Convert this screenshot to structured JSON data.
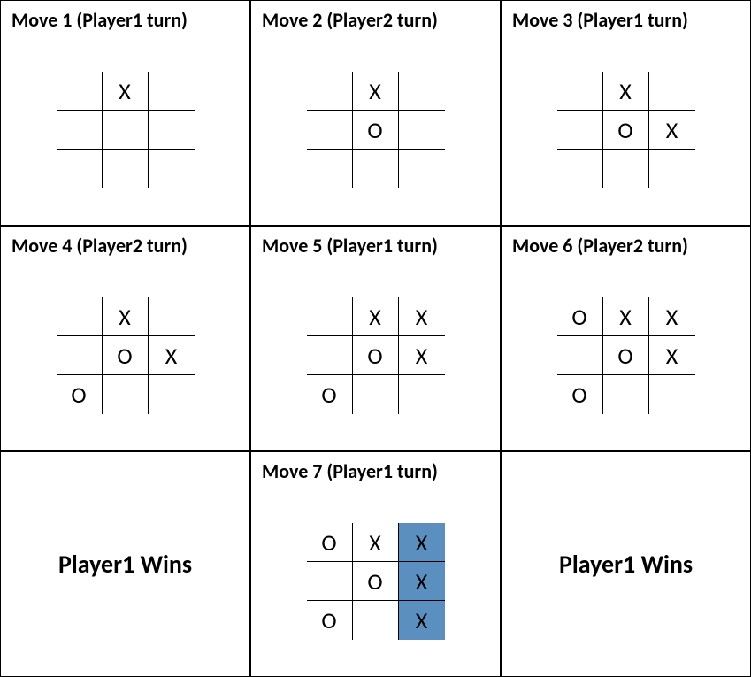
{
  "panels": [
    {
      "type": "move",
      "title": "Move 1 (Player1 turn)",
      "board": [
        [
          "",
          "X",
          ""
        ],
        [
          "",
          "",
          ""
        ],
        [
          "",
          "",
          ""
        ]
      ],
      "highlight": []
    },
    {
      "type": "move",
      "title": "Move 2 (Player2 turn)",
      "board": [
        [
          "",
          "X",
          ""
        ],
        [
          "",
          "O",
          ""
        ],
        [
          "",
          "",
          ""
        ]
      ],
      "highlight": []
    },
    {
      "type": "move",
      "title": "Move 3 (Player1 turn)",
      "board": [
        [
          "",
          "X",
          ""
        ],
        [
          "",
          "O",
          "X"
        ],
        [
          "",
          "",
          ""
        ]
      ],
      "highlight": []
    },
    {
      "type": "move",
      "title": "Move 4 (Player2 turn)",
      "board": [
        [
          "",
          "X",
          ""
        ],
        [
          "",
          "O",
          "X"
        ],
        [
          "O",
          "",
          ""
        ]
      ],
      "highlight": []
    },
    {
      "type": "move",
      "title": "Move 5 (Player1 turn)",
      "board": [
        [
          "",
          "X",
          "X"
        ],
        [
          "",
          "O",
          "X"
        ],
        [
          "O",
          "",
          ""
        ]
      ],
      "highlight": []
    },
    {
      "type": "move",
      "title": "Move 6 (Player2 turn)",
      "board": [
        [
          "O",
          "X",
          "X"
        ],
        [
          "",
          "O",
          "X"
        ],
        [
          "O",
          "",
          ""
        ]
      ],
      "highlight": []
    },
    {
      "type": "win",
      "text": "Player1 Wins"
    },
    {
      "type": "move",
      "title": "Move 7 (Player1 turn)",
      "board": [
        [
          "O",
          "X",
          "X"
        ],
        [
          "",
          "O",
          "X"
        ],
        [
          "O",
          "",
          "X"
        ]
      ],
      "highlight": [
        [
          0,
          2
        ],
        [
          1,
          2
        ],
        [
          2,
          2
        ]
      ]
    },
    {
      "type": "win",
      "text": "Player1 Wins"
    }
  ],
  "highlight_color": "#5b8fbf"
}
